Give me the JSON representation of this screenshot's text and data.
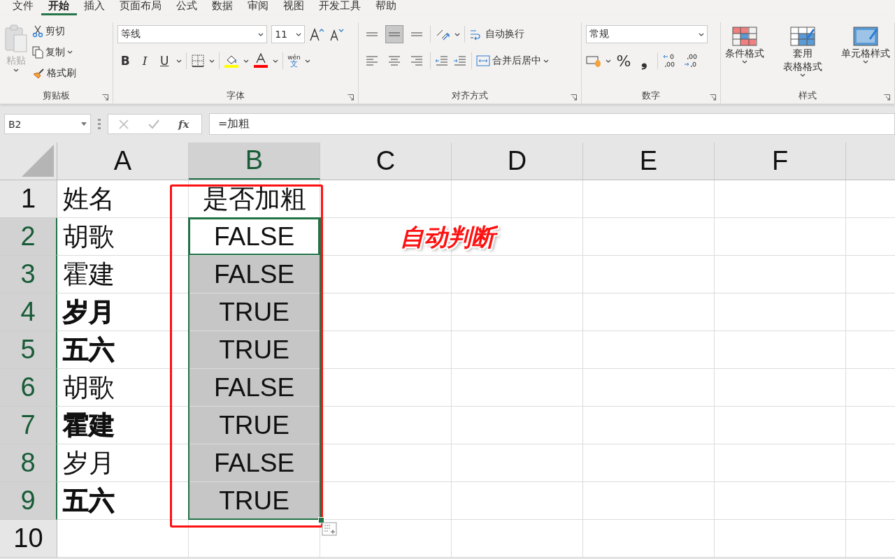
{
  "menu_tabs": [
    {
      "label": "文件",
      "selected": false
    },
    {
      "label": "开始",
      "selected": true
    },
    {
      "label": "插入",
      "selected": false
    },
    {
      "label": "页面布局",
      "selected": false
    },
    {
      "label": "公式",
      "selected": false
    },
    {
      "label": "数据",
      "selected": false
    },
    {
      "label": "审阅",
      "selected": false
    },
    {
      "label": "视图",
      "selected": false
    },
    {
      "label": "开发工具",
      "selected": false
    },
    {
      "label": "帮助",
      "selected": false
    }
  ],
  "ribbon": {
    "clipboard": {
      "paste": "粘贴",
      "cut": "剪切",
      "copy": "复制",
      "painter": "格式刷",
      "label": "剪贴板"
    },
    "font": {
      "font_name": "等线",
      "font_size": "11",
      "bold": "B",
      "italic": "I",
      "underline": "U",
      "phonetic_top": "wén",
      "phonetic_bottom": "文",
      "label": "字体"
    },
    "alignment": {
      "align_buttons": [
        {
          "kind": "top",
          "selected": false
        },
        {
          "kind": "middle",
          "selected": true
        },
        {
          "kind": "bottom",
          "selected": false
        },
        {
          "kind": "left",
          "selected": false
        },
        {
          "kind": "center",
          "selected": false
        },
        {
          "kind": "right",
          "selected": false
        }
      ],
      "wrap": "自动换行",
      "merge": "合并后居中",
      "label": "对齐方式"
    },
    "number": {
      "format": "常规",
      "percent": "%",
      "comma": "❟",
      "label": "数字"
    },
    "styles": {
      "conditional": "条件格式",
      "table_line1": "套用",
      "table_line2": "表格格式",
      "cell_styles": "单元格样式",
      "label": "样式"
    }
  },
  "name_box": "B2",
  "function_button": "fx",
  "formula": "=加粗",
  "columns": [
    {
      "label": "A",
      "selected": false
    },
    {
      "label": "B",
      "selected": true
    },
    {
      "label": "C",
      "selected": false
    },
    {
      "label": "D",
      "selected": false
    },
    {
      "label": "E",
      "selected": false
    },
    {
      "label": "F",
      "selected": false
    }
  ],
  "rows": [
    {
      "number": "1",
      "selected": false,
      "cells": [
        {
          "text": "姓名",
          "bold": false
        },
        {
          "text": "是否加粗",
          "selected": false,
          "active": false
        }
      ]
    },
    {
      "number": "2",
      "selected": true,
      "cells": [
        {
          "text": "胡歌",
          "bold": false
        },
        {
          "text": "FALSE",
          "selected": false,
          "active": true
        }
      ]
    },
    {
      "number": "3",
      "selected": true,
      "cells": [
        {
          "text": "霍建",
          "bold": false
        },
        {
          "text": "FALSE",
          "selected": true,
          "active": false
        }
      ]
    },
    {
      "number": "4",
      "selected": true,
      "cells": [
        {
          "text": "岁月",
          "bold": true
        },
        {
          "text": "TRUE",
          "selected": true,
          "active": false
        }
      ]
    },
    {
      "number": "5",
      "selected": true,
      "cells": [
        {
          "text": "五六",
          "bold": true
        },
        {
          "text": "TRUE",
          "selected": true,
          "active": false
        }
      ]
    },
    {
      "number": "6",
      "selected": true,
      "cells": [
        {
          "text": "胡歌",
          "bold": false
        },
        {
          "text": "FALSE",
          "selected": true,
          "active": false
        }
      ]
    },
    {
      "number": "7",
      "selected": true,
      "cells": [
        {
          "text": "霍建",
          "bold": true
        },
        {
          "text": "TRUE",
          "selected": true,
          "active": false
        }
      ]
    },
    {
      "number": "8",
      "selected": true,
      "cells": [
        {
          "text": "岁月",
          "bold": false
        },
        {
          "text": "FALSE",
          "selected": true,
          "active": false
        }
      ]
    },
    {
      "number": "9",
      "selected": true,
      "cells": [
        {
          "text": "五六",
          "bold": true
        },
        {
          "text": "TRUE",
          "selected": true,
          "active": false
        }
      ]
    },
    {
      "number": "10",
      "selected": false,
      "cells": []
    }
  ],
  "annotation": {
    "text": "自动判断"
  }
}
